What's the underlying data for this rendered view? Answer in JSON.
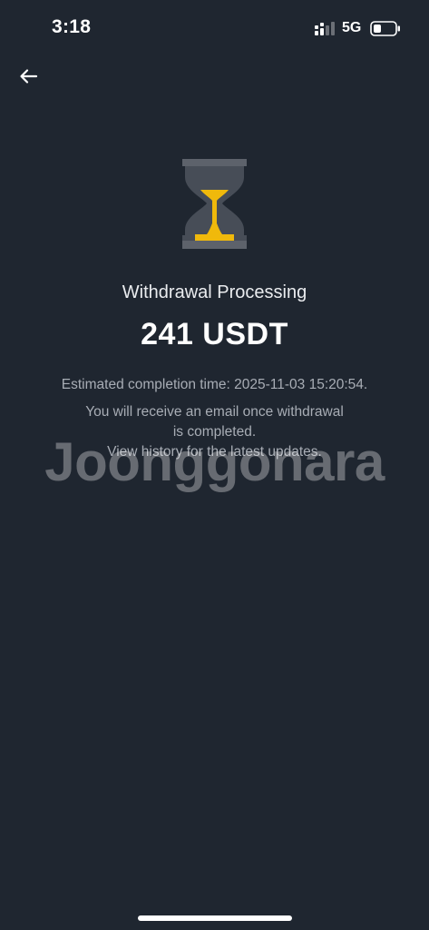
{
  "status_bar": {
    "time": "3:18",
    "network": "5G",
    "icons": [
      "signal-icon",
      "battery-icon"
    ]
  },
  "nav": {
    "back_icon": "arrow-left-icon"
  },
  "main": {
    "status_icon": "hourglass-icon",
    "title": "Withdrawal Processing",
    "amount": "241 USDT",
    "estimate": "Estimated completion time: 2025-11-03 15:20:54.",
    "info_lines": [
      "You will receive an email once withdrawal",
      "is completed.",
      "View history for the latest updates."
    ]
  },
  "watermark": "Joonggonara",
  "colors": {
    "background": "#1f2630",
    "accent": "#f0b90b",
    "hourglass_frame": "#474d57",
    "text_primary": "#eaecef",
    "text_secondary": "#a8adb5"
  }
}
